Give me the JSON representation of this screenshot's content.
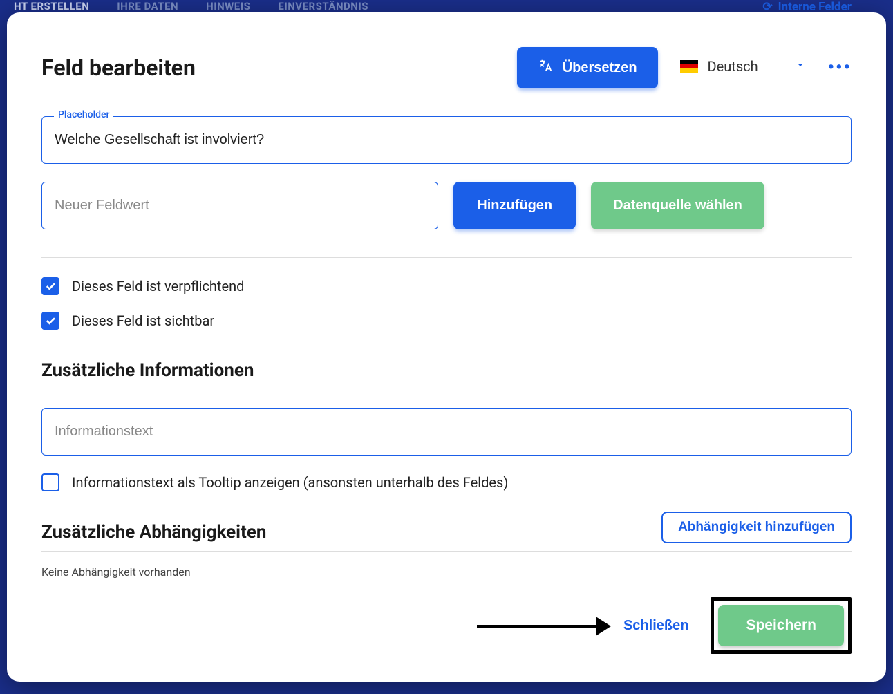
{
  "bg": {
    "nav": [
      "HT ERSTELLEN",
      "IHRE DATEN",
      "HINWEIS",
      "EINVERSTÄNDNIS"
    ],
    "right": "Interne Felder"
  },
  "modal": {
    "title": "Feld bearbeiten",
    "translate_label": "Übersetzen",
    "language": "Deutsch"
  },
  "placeholder": {
    "label": "Placeholder",
    "value": "Welche Gesellschaft ist involviert?"
  },
  "new_value": {
    "placeholder": "Neuer Feldwert",
    "add_label": "Hinzufügen",
    "datasource_label": "Datenquelle wählen"
  },
  "checks": {
    "required": "Dieses Feld ist verpflichtend",
    "visible": "Dieses Feld ist sichtbar"
  },
  "info_section": {
    "title": "Zusätzliche Informationen",
    "placeholder": "Informationstext",
    "tooltip_check": "Informationstext als Tooltip anzeigen (ansonsten unterhalb des Feldes)"
  },
  "deps_section": {
    "title": "Zusätzliche Abhängigkeiten",
    "add_label": "Abhängigkeit hinzufügen",
    "empty": "Keine Abhängigkeit vorhanden"
  },
  "footer": {
    "close": "Schließen",
    "save": "Speichern"
  }
}
